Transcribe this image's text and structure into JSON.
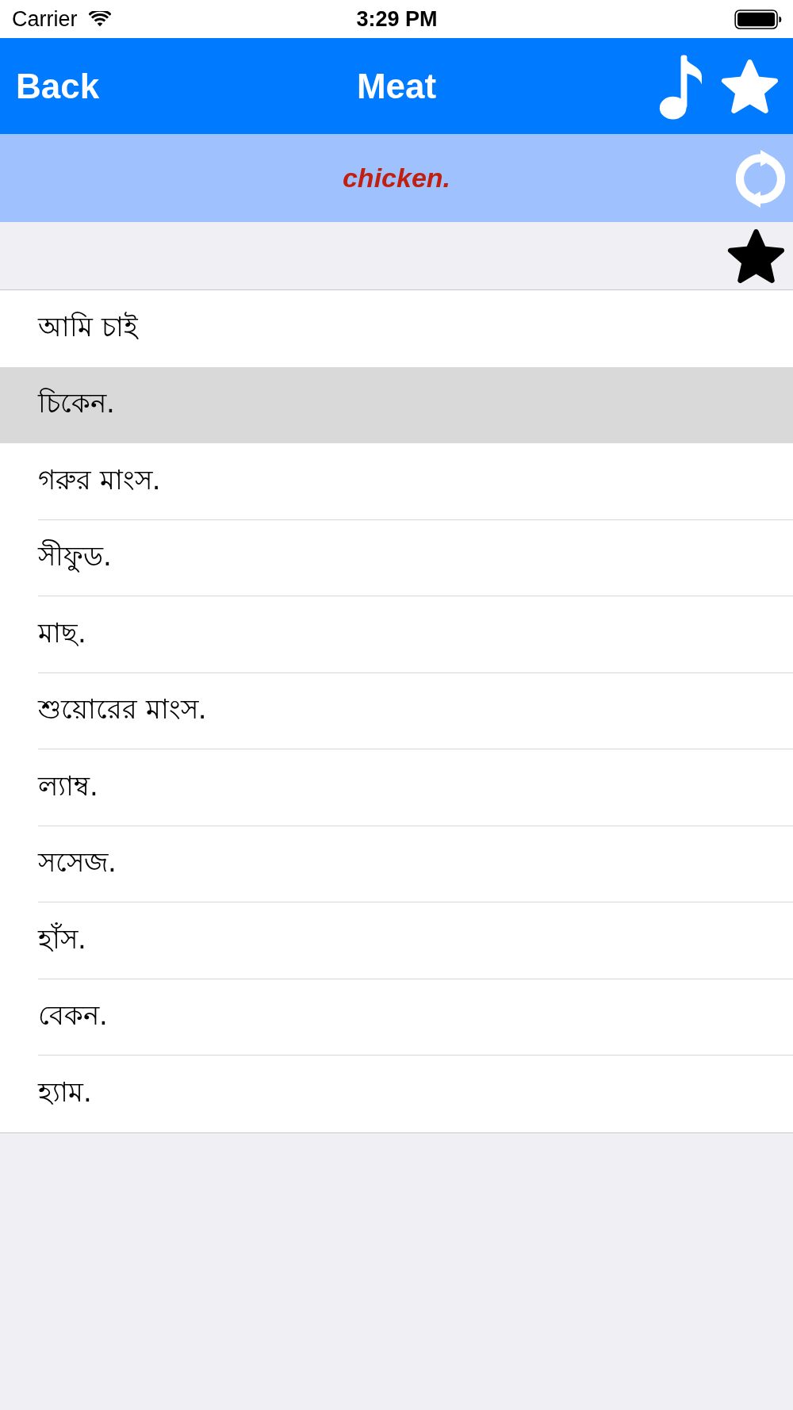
{
  "status_bar": {
    "carrier": "Carrier",
    "time": "3:29 PM"
  },
  "nav_bar": {
    "back": "Back",
    "title": "Meat"
  },
  "translation": {
    "text": "chicken."
  },
  "phrases": [
    {
      "text": "আমি চাই",
      "selected": false
    },
    {
      "text": "চিকেন.",
      "selected": true
    },
    {
      "text": "গরুর মাংস.",
      "selected": false
    },
    {
      "text": "সীফুড.",
      "selected": false
    },
    {
      "text": "মাছ.",
      "selected": false
    },
    {
      "text": "শুয়োরের মাংস.",
      "selected": false
    },
    {
      "text": "ল্যাম্ব.",
      "selected": false
    },
    {
      "text": "সসেজ.",
      "selected": false
    },
    {
      "text": "হাঁস.",
      "selected": false
    },
    {
      "text": "বেকন.",
      "selected": false
    },
    {
      "text": "হ্যাম.",
      "selected": false
    }
  ]
}
